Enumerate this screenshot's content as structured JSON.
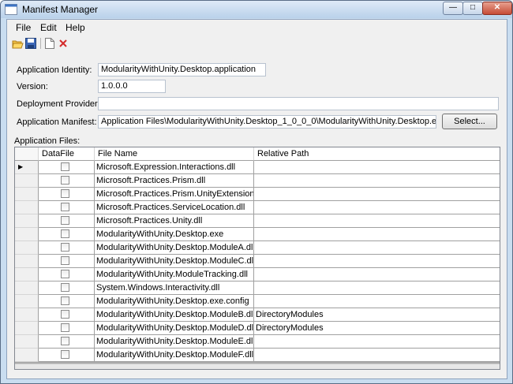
{
  "window": {
    "title": "Manifest Manager",
    "controls": {
      "minimize": "—",
      "maximize": "□",
      "close": "✕"
    }
  },
  "menu": {
    "items": [
      "File",
      "Edit",
      "Help"
    ]
  },
  "toolbar": {
    "icons": [
      "folder-open-icon",
      "save-icon",
      "new-document-icon",
      "delete-icon"
    ]
  },
  "form": {
    "application_identity": {
      "label": "Application Identity:",
      "value": "ModularityWithUnity.Desktop.application"
    },
    "version": {
      "label": "Version:",
      "value": "1.0.0.0"
    },
    "deployment_provider": {
      "label": "Deployment Provider:",
      "value": ""
    },
    "application_manifest": {
      "label": "Application Manifest:",
      "value": "Application Files\\ModularityWithUnity.Desktop_1_0_0_0\\ModularityWithUnity.Desktop.exe.manifest"
    },
    "select_button": "Select..."
  },
  "files": {
    "label": "Application Files:",
    "columns": [
      "DataFile",
      "File Name",
      "Relative Path"
    ],
    "rows": [
      {
        "file": "Microsoft.Expression.Interactions.dll",
        "path": "",
        "checked": false
      },
      {
        "file": "Microsoft.Practices.Prism.dll",
        "path": "",
        "checked": false
      },
      {
        "file": "Microsoft.Practices.Prism.UnityExtensions.dll",
        "path": "",
        "checked": false
      },
      {
        "file": "Microsoft.Practices.ServiceLocation.dll",
        "path": "",
        "checked": false
      },
      {
        "file": "Microsoft.Practices.Unity.dll",
        "path": "",
        "checked": false
      },
      {
        "file": "ModularityWithUnity.Desktop.exe",
        "path": "",
        "checked": false
      },
      {
        "file": "ModularityWithUnity.Desktop.ModuleA.dll",
        "path": "",
        "checked": false
      },
      {
        "file": "ModularityWithUnity.Desktop.ModuleC.dll",
        "path": "",
        "checked": false
      },
      {
        "file": "ModularityWithUnity.ModuleTracking.dll",
        "path": "",
        "checked": false
      },
      {
        "file": "System.Windows.Interactivity.dll",
        "path": "",
        "checked": false
      },
      {
        "file": "ModularityWithUnity.Desktop.exe.config",
        "path": "",
        "checked": false
      },
      {
        "file": "ModularityWithUnity.Desktop.ModuleB.dll",
        "path": "DirectoryModules",
        "checked": false
      },
      {
        "file": "ModularityWithUnity.Desktop.ModuleD.dll",
        "path": "DirectoryModules",
        "checked": false
      },
      {
        "file": "ModularityWithUnity.Desktop.ModuleE.dll",
        "path": "",
        "checked": false
      },
      {
        "file": "ModularityWithUnity.Desktop.ModuleF.dll",
        "path": "",
        "checked": false
      }
    ]
  }
}
